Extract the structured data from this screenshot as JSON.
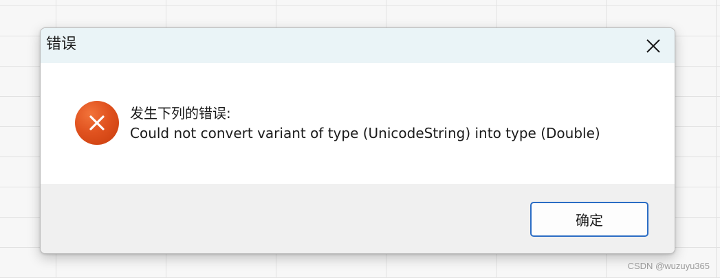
{
  "dialog": {
    "title": "错误",
    "close_icon": "close-icon",
    "error_icon": "error-x-icon",
    "message_line1": "发生下列的错误:",
    "message_line2": "Could not convert variant of type (UnicodeString) into type (Double)",
    "ok_label": "确定"
  },
  "colors": {
    "titlebar_bg": "#eaf4f7",
    "error_icon": "#e0521f",
    "button_border": "#2a6cc4",
    "footer_bg": "#f0f0f0"
  },
  "watermark": "CSDN @wuzuyu365"
}
